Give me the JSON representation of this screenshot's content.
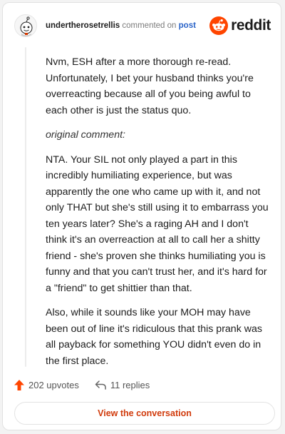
{
  "header": {
    "username": "undertherosetrellis",
    "action_text": "commented on",
    "post_link": "post",
    "brand": "reddit"
  },
  "comment": {
    "paragraphs": [
      "Nvm, ESH after a more thorough re-read. Unfortunately, I bet your husband thinks you're overreacting because all of you being awful to each other is just the status quo.",
      "original comment:",
      "NTA. Your SIL not only played a part in this incredibly humiliating experience, but was apparently the one who came up with it, and not only THAT but she's still using it to embarrass you ten years later? She's a raging AH and I don't think it's an overreaction at all to call her a shitty friend - she's proven she thinks humiliating you is funny and that you can't trust her, and it's hard for a \"friend\" to get shittier than that.",
      "Also, while it sounds like your MOH may have been out of line it's ridiculous that this prank was all payback for something YOU didn't even do in the first place."
    ]
  },
  "stats": {
    "upvotes": "202 upvotes",
    "replies": "11 replies"
  },
  "cta": {
    "label": "View the conversation"
  },
  "colors": {
    "brand": "#ff4500",
    "link": "#2a63c8",
    "cta": "#d13b0c"
  },
  "icons": [
    "snoo-avatar-icon",
    "reddit-logo-icon",
    "upvote-arrow-icon",
    "reply-arrow-icon"
  ]
}
